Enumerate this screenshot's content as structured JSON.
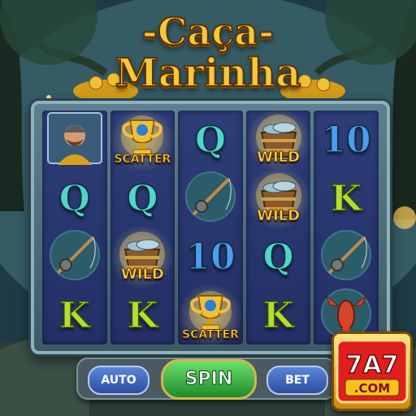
{
  "game": {
    "title_line1": "-Caça-",
    "title_line2": "Marinha"
  },
  "reels": [
    [
      {
        "symbol": "fisherman-icon",
        "label": "",
        "letter": ""
      },
      {
        "symbol": "letter-q",
        "label": "",
        "letter": "Q",
        "color": "#4fd6c8"
      },
      {
        "symbol": "fishing-rod-icon",
        "label": "",
        "letter": ""
      },
      {
        "symbol": "letter-k",
        "label": "",
        "letter": "K",
        "color": "#b6dc32"
      }
    ],
    [
      {
        "symbol": "trophy-scatter-icon",
        "label": "SCATTER",
        "letter": ""
      },
      {
        "symbol": "letter-q",
        "label": "",
        "letter": "Q",
        "color": "#4fd6c8"
      },
      {
        "symbol": "fish-bucket-wild-icon",
        "label": "WILD",
        "letter": ""
      },
      {
        "symbol": "letter-k",
        "label": "",
        "letter": "K",
        "color": "#b6dc32"
      }
    ],
    [
      {
        "symbol": "letter-q",
        "label": "",
        "letter": "Q",
        "color": "#4fd6c8"
      },
      {
        "symbol": "fishing-rod-icon",
        "label": "",
        "letter": ""
      },
      {
        "symbol": "number-10",
        "label": "",
        "letter": "10",
        "color": "#4a9ef0"
      },
      {
        "symbol": "trophy-scatter-icon",
        "label": "SCATTER",
        "letter": ""
      }
    ],
    [
      {
        "symbol": "fish-bucket-wild-icon",
        "label": "WILD",
        "letter": ""
      },
      {
        "symbol": "fish-bucket-wild-icon",
        "label": "WILD",
        "letter": ""
      },
      {
        "symbol": "letter-q",
        "label": "",
        "letter": "Q",
        "color": "#4fd6c8"
      },
      {
        "symbol": "letter-k",
        "label": "",
        "letter": "K",
        "color": "#b6dc32"
      }
    ],
    [
      {
        "symbol": "number-10",
        "label": "",
        "letter": "10",
        "color": "#4a9ef0"
      },
      {
        "symbol": "letter-k",
        "label": "",
        "letter": "K",
        "color": "#b6dc32"
      },
      {
        "symbol": "fishing-rod-icon",
        "label": "",
        "letter": ""
      },
      {
        "symbol": "lobster-icon",
        "label": "",
        "letter": ""
      }
    ]
  ],
  "controls": {
    "auto_label": "AUTO",
    "spin_label": "SPIN",
    "bet_label": "BET"
  },
  "logo": {
    "main": "7A7",
    "sub": ".COM"
  }
}
